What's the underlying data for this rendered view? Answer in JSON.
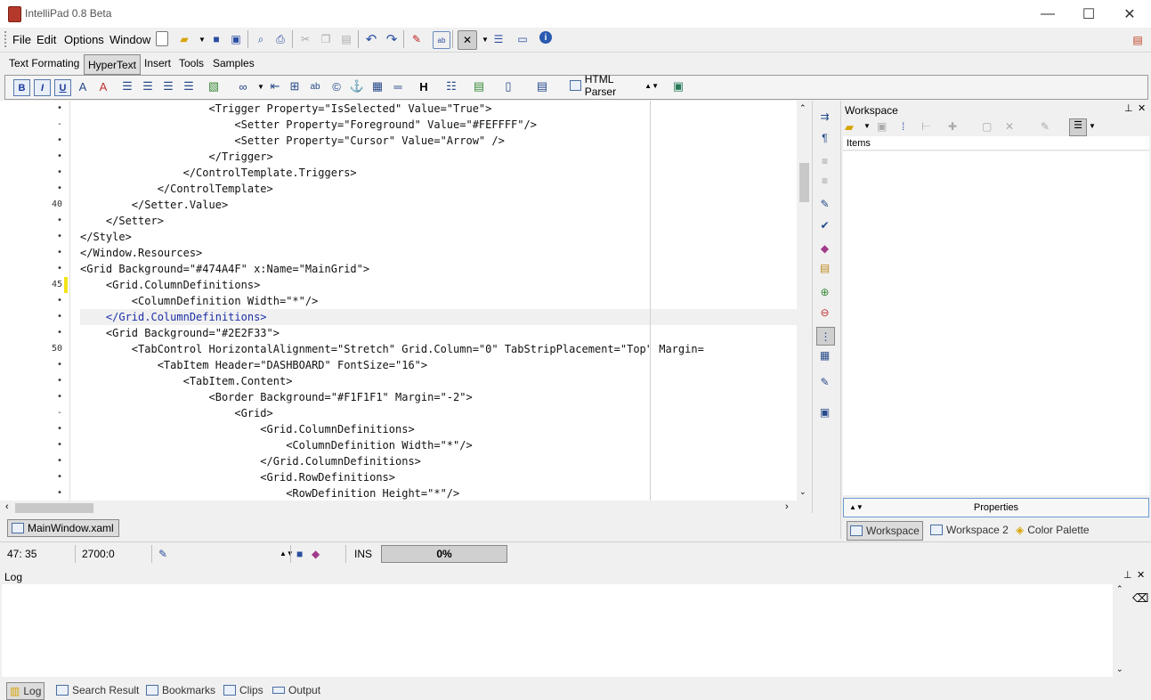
{
  "window": {
    "title": "IntelliPad 0.8 Beta",
    "minimize": "—",
    "maximize": "☐",
    "close": "✕"
  },
  "menu": [
    "File",
    "Edit",
    "Options",
    "Window"
  ],
  "ribbon_tabs": [
    "Text Formating",
    "HyperText",
    "Insert",
    "Tools",
    "Samples"
  ],
  "format_toolbar": {
    "parser": "HTML Parser"
  },
  "editor": {
    "line_numbers": [
      "•",
      "-",
      "•",
      "•",
      "•",
      "•",
      "40",
      "•",
      "•",
      "•",
      "•",
      "45",
      "•",
      "•",
      "•",
      "50",
      "•",
      "•",
      "•",
      "-",
      "•",
      "•",
      "•"
    ],
    "lines": [
      "                    <Trigger Property=\"IsSelected\" Value=\"True\">",
      "                        <Setter Property=\"Foreground\" Value=\"#FEFFFF\"/>",
      "                        <Setter Property=\"Cursor\" Value=\"Arrow\" />",
      "                    </Trigger>",
      "                </ControlTemplate.Triggers>",
      "            </ControlTemplate>",
      "        </Setter.Value>",
      "    </Setter>",
      "</Style>",
      "</Window.Resources>",
      "<Grid Background=\"#474A4F\" x:Name=\"MainGrid\">",
      "    <Grid.ColumnDefinitions>",
      "        <ColumnDefinition Width=\"*\"/>",
      "    </Grid.ColumnDefinitions>",
      "    <Grid Background=\"#2E2F33\">",
      "        <TabControl HorizontalAlignment=\"Stretch\" Grid.Column=\"0\" TabStripPlacement=\"Top\" Margin=",
      "            <TabItem Header=\"DASHBOARD\" FontSize=\"16\">",
      "                <TabItem.Content>",
      "                    <Border Background=\"#F1F1F1\" Margin=\"-2\">",
      "                        <Grid>",
      "                            <Grid.ColumnDefinitions>",
      "                                <ColumnDefinition Width=\"*\"/>",
      "                            </Grid.ColumnDefinitions>",
      "                            <Grid.RowDefinitions>",
      "                                <RowDefinition Height=\"*\"/>"
    ],
    "line_indent_base": [
      8,
      8,
      8,
      8,
      8,
      8,
      8,
      8,
      8,
      2,
      2,
      2,
      2,
      2,
      2,
      2,
      2,
      2,
      2,
      2,
      2,
      2,
      2,
      2,
      2
    ],
    "current_line_index": 13
  },
  "doc_tab": "MainWindow.xaml",
  "workspace": {
    "title": "Workspace",
    "items_header": "Items",
    "properties_label": "Properties",
    "tabs": [
      "Workspace",
      "Workspace 2",
      "Color Palette"
    ]
  },
  "status": {
    "position": "47: 35",
    "size": "2700:0",
    "mode": "INS",
    "progress": "0%"
  },
  "log": {
    "title": "Log",
    "tabs": [
      "Log",
      "Search Result",
      "Bookmarks",
      "Clips",
      "Output"
    ]
  },
  "colors": {
    "accent": "#1c2fa8",
    "change_marker": "#f2e31a",
    "app_icon": "#b5392b"
  }
}
